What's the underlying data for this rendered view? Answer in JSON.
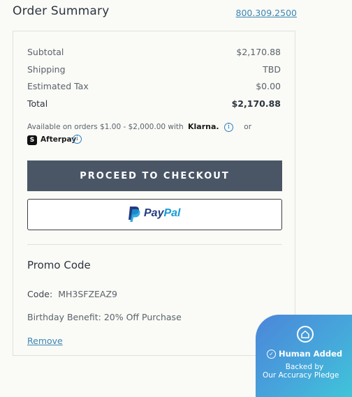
{
  "header": {
    "title": "Order Summary",
    "phone": "800.309.2500"
  },
  "summary": {
    "rows": [
      {
        "label": "Subtotal",
        "value": "$2,170.88"
      },
      {
        "label": "Shipping",
        "value": "TBD"
      },
      {
        "label": "Estimated Tax",
        "value": "$0.00"
      },
      {
        "label": "Total",
        "value": "$2,170.88"
      }
    ]
  },
  "financing": {
    "available_text": "Available on orders $1.00 - $2,000.00 with",
    "klarna": "Klarna.",
    "or": "or",
    "afterpay": "Afterpay",
    "info_icon": "info-icon"
  },
  "buttons": {
    "checkout": "PROCEED TO CHECKOUT",
    "paypal_pay": "Pay",
    "paypal_pal": "Pal"
  },
  "promo": {
    "title": "Promo Code",
    "code_label": "Code:",
    "code_value": "MH3SFZEAZ9",
    "benefit": "Birthday Benefit: 20% Off Purchase",
    "remove": "Remove"
  },
  "badge": {
    "line1": "Human Added",
    "line2": "Backed by",
    "line3": "Our Accuracy Pledge"
  },
  "colors": {
    "checkout_bg": "#4a5666",
    "link": "#3a86b4",
    "badge_start": "#4b86d9",
    "badge_end": "#3fc8d8"
  }
}
